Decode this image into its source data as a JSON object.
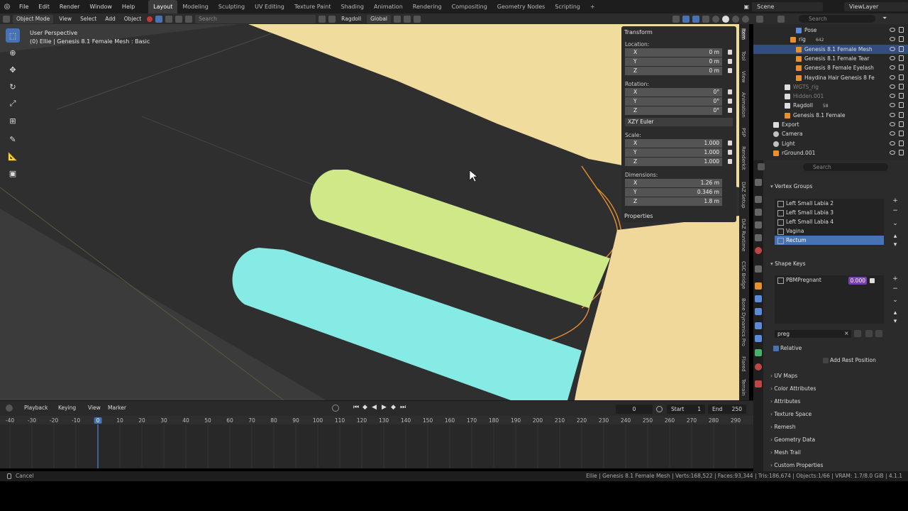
{
  "topbar": {
    "menus": [
      "File",
      "Edit",
      "Render",
      "Window",
      "Help"
    ],
    "workspaces": [
      "Layout",
      "Modeling",
      "Sculpting",
      "UV Editing",
      "Texture Paint",
      "Shading",
      "Animation",
      "Rendering",
      "Compositing",
      "Geometry Nodes",
      "Scripting"
    ],
    "active_workspace": "Layout",
    "add_tab": "+",
    "scene": "Scene",
    "view_layer": "ViewLayer"
  },
  "viewport_header": {
    "mode": "Object Mode",
    "menus": [
      "View",
      "Select",
      "Add",
      "Object"
    ],
    "search_placeholder": "Search",
    "ragdoll": "Ragdoll",
    "orientation": "Global"
  },
  "viewport": {
    "info_line1": "User Perspective",
    "info_line2": "(0) Ellie | Genesis 8.1 Female Mesh : Basic"
  },
  "npanel": {
    "transform_title": "Transform",
    "location_label": "Location:",
    "location": [
      {
        "axis": "X",
        "value": "0 m"
      },
      {
        "axis": "Y",
        "value": "0 m"
      },
      {
        "axis": "Z",
        "value": "0 m"
      }
    ],
    "rotation_label": "Rotation:",
    "rotation": [
      {
        "axis": "X",
        "value": "0°"
      },
      {
        "axis": "Y",
        "value": "0°"
      },
      {
        "axis": "Z",
        "value": "0°"
      }
    ],
    "rotation_mode": "XZY Euler",
    "scale_label": "Scale:",
    "scale": [
      {
        "axis": "X",
        "value": "1.000"
      },
      {
        "axis": "Y",
        "value": "1.000"
      },
      {
        "axis": "Z",
        "value": "1.000"
      }
    ],
    "dimensions_label": "Dimensions:",
    "dimensions": [
      {
        "axis": "X",
        "value": "1.26 m"
      },
      {
        "axis": "Y",
        "value": "0.346 m"
      },
      {
        "axis": "Z",
        "value": "1.8 m"
      }
    ],
    "properties_title": "Properties"
  },
  "side_tabs": [
    "Item",
    "Tool",
    "View",
    "Animation",
    "PSP",
    "Renderkit",
    "DAZ Setup",
    "DAZ Runtime",
    "CSC Bridge",
    "Bone Dynamics Pro",
    "Flared",
    "Terrain"
  ],
  "outliner": {
    "search_placeholder": "Search",
    "rows": [
      {
        "name": "Pose",
        "indent": 60,
        "type": "pose",
        "sel": false,
        "dim": false
      },
      {
        "name": "rig",
        "indent": 52,
        "type": "armature",
        "sel": false,
        "dim": false,
        "extra": "642"
      },
      {
        "name": "Genesis 8.1 Female Mesh",
        "indent": 60,
        "type": "mesh",
        "sel": true,
        "dim": false
      },
      {
        "name": "Genesis 8.1 Female Tear",
        "indent": 60,
        "type": "mesh",
        "sel": false,
        "dim": false
      },
      {
        "name": "Genesis 8 Female Eyelash",
        "indent": 60,
        "type": "mesh",
        "sel": false,
        "dim": false
      },
      {
        "name": "Haydina Hair Genesis 8 Fe",
        "indent": 60,
        "type": "mesh",
        "sel": false,
        "dim": false
      },
      {
        "name": "WGTS_rig",
        "indent": 44,
        "type": "collection",
        "sel": false,
        "dim": true
      },
      {
        "name": "Hidden.001",
        "indent": 44,
        "type": "collection",
        "sel": false,
        "dim": true
      },
      {
        "name": "Ragdoll",
        "indent": 44,
        "type": "collection",
        "sel": false,
        "dim": false,
        "extra": "58"
      },
      {
        "name": "Genesis 8.1 Female",
        "indent": 44,
        "type": "armature",
        "sel": false,
        "dim": false
      },
      {
        "name": "Export",
        "indent": 28,
        "type": "collection",
        "sel": false,
        "dim": false
      },
      {
        "name": "Camera",
        "indent": 28,
        "type": "camera",
        "sel": false,
        "dim": false
      },
      {
        "name": "Light",
        "indent": 28,
        "type": "light",
        "sel": false,
        "dim": false
      },
      {
        "name": "rGround.001",
        "indent": 28,
        "type": "mesh",
        "sel": false,
        "dim": false
      }
    ]
  },
  "properties": {
    "search_placeholder": "Search",
    "vertex_groups_title": "Vertex Groups",
    "vertex_groups": [
      "Left Small Labia 2",
      "Left Small Labia 3",
      "Left Small Labia 4",
      "Vagina",
      "Rectum"
    ],
    "selected_vertex_group": "Rectum",
    "shape_keys_title": "Shape Keys",
    "shape_key": "PBMPregnant",
    "shape_key_value": "0.000",
    "filter_text": "preg",
    "relative_label": "Relative",
    "add_rest_label": "Add Rest Position",
    "collapsed_sections": [
      "UV Maps",
      "Color Attributes",
      "Attributes",
      "Texture Space",
      "Remesh",
      "Geometry Data",
      "Mesh Trail",
      "Custom Properties"
    ]
  },
  "timeline": {
    "menus": [
      "Playback",
      "Keying",
      "View",
      "Marker"
    ],
    "current_frame": "0",
    "start_label": "Start",
    "start": "1",
    "end_label": "End",
    "end": "250",
    "ticks": [
      -40,
      -30,
      -20,
      -10,
      0,
      10,
      20,
      30,
      40,
      50,
      60,
      70,
      80,
      90,
      100,
      110,
      120,
      130,
      140,
      150,
      160,
      170,
      180,
      190,
      200,
      210,
      220,
      230,
      240,
      250,
      260,
      270,
      280,
      290
    ]
  },
  "status": {
    "left": "Cancel",
    "right": "Ellie | Genesis 8.1 Female Mesh | Verts:168,522 | Faces:93,344 | Tris:186,674 | Objects:1/66 | VRAM: 1.7/8.0 GiB | 4.1.1"
  },
  "colors": {
    "accent": "#4772b3",
    "selected_row": "#334d80",
    "green_tube": "#cfe888",
    "cyan_tube": "#7fe8e0",
    "skin": "#f2dc9c",
    "hair": "#e88f2e"
  }
}
